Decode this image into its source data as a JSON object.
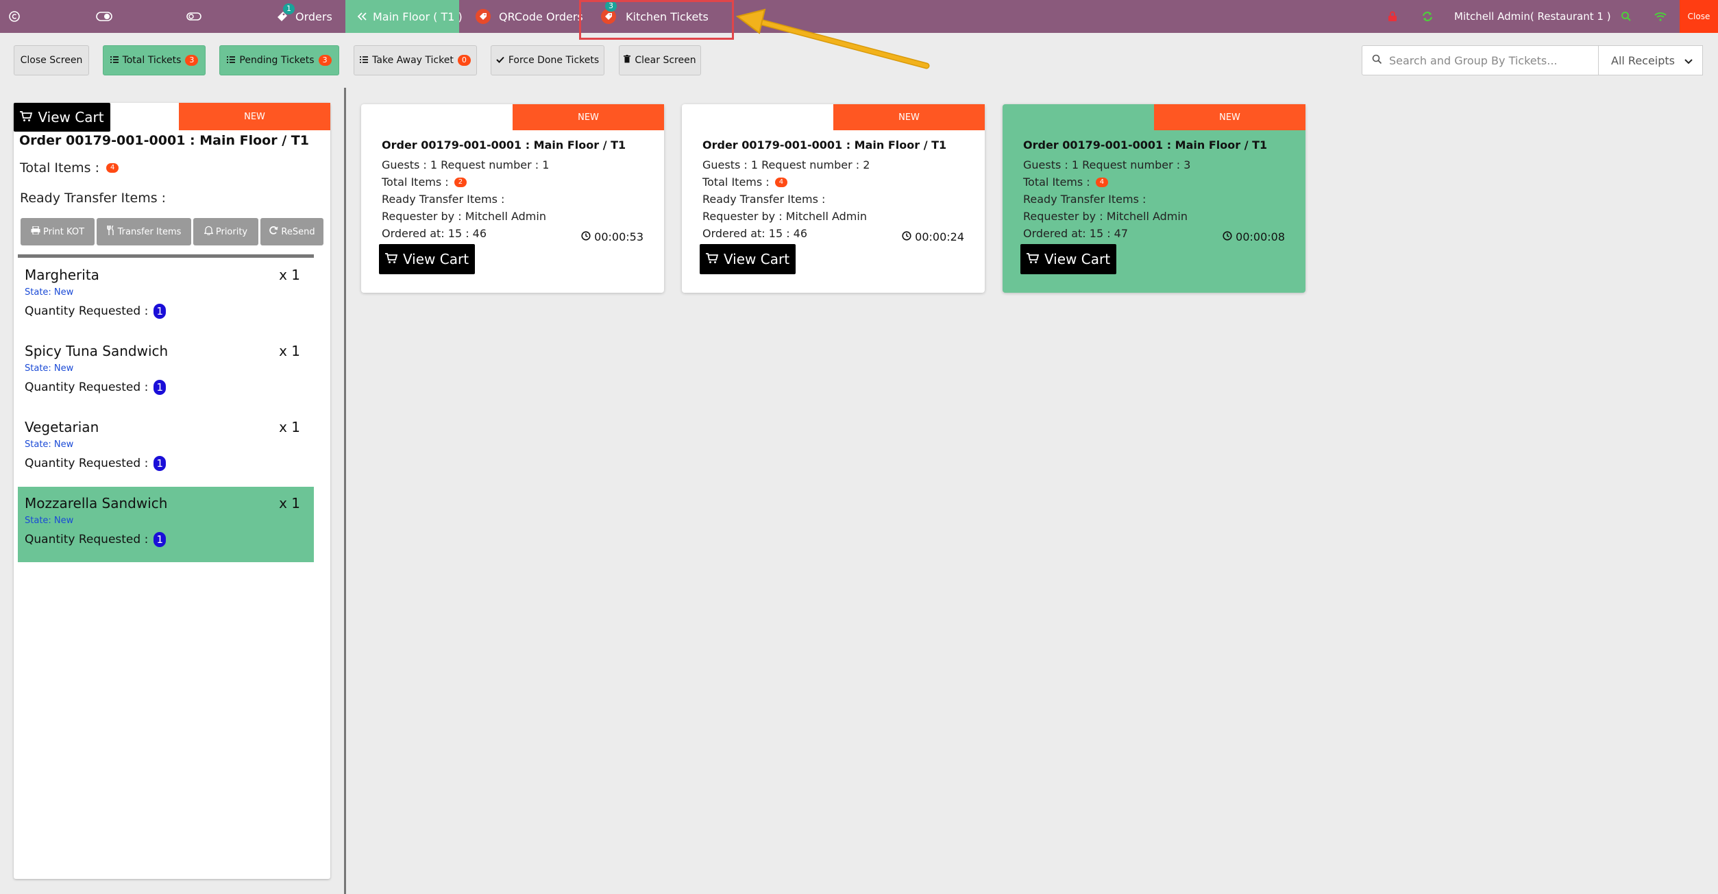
{
  "topbar": {
    "orders_label": "Orders",
    "orders_count": "1",
    "main_floor_label": "Main Floor ( T1 )",
    "qrcode_label": "QRCode Orders",
    "kitchen_label": "Kitchen Tickets",
    "kitchen_count": "3",
    "user_label": "Mitchell Admin( Restaurant 1 )",
    "close_label": "Close"
  },
  "toolbar": {
    "close_screen": "Close Screen",
    "total_tickets": "Total Tickets",
    "total_tickets_count": "3",
    "pending_tickets": "Pending Tickets",
    "pending_tickets_count": "3",
    "take_away": "Take Away Ticket",
    "take_away_count": "0",
    "force_done": "Force Done Tickets",
    "clear_screen": "Clear Screen",
    "search_placeholder": "Search and Group By Tickets...",
    "receipts_select": "All Receipts"
  },
  "left_panel": {
    "status": "NEW",
    "view_cart": "View Cart",
    "order_title": "Order 00179-001-0001 : Main Floor / T1",
    "total_items_label": "Total Items :",
    "total_items_count": "4",
    "ready_transfer_label": "Ready Transfer Items :",
    "actions": {
      "print": "Print KOT",
      "transfer": "Transfer Items",
      "priority": "Priority",
      "resend": "ReSend"
    },
    "items": [
      {
        "name": "Margherita",
        "qty": "x 1",
        "state": "State: New",
        "qty_requested_label": "Quantity Requested :",
        "qty_requested": "1"
      },
      {
        "name": "Spicy Tuna Sandwich",
        "qty": "x 1",
        "state": "State: New",
        "qty_requested_label": "Quantity Requested :",
        "qty_requested": "1"
      },
      {
        "name": "Vegetarian",
        "qty": "x 1",
        "state": "State: New",
        "qty_requested_label": "Quantity Requested :",
        "qty_requested": "1"
      },
      {
        "name": "Mozzarella Sandwich",
        "qty": "x 1",
        "state": "State: New",
        "qty_requested_label": "Quantity Requested :",
        "qty_requested": "1"
      }
    ]
  },
  "cards": [
    {
      "status": "NEW",
      "title": "Order 00179-001-0001 : Main Floor / T1",
      "guests": "Guests : 1 Request number : 1",
      "total_items_label": "Total Items :",
      "total_items": "2",
      "ready_transfer": "Ready Transfer Items :",
      "requester": "Requester by : Mitchell Admin",
      "ordered_at": "Ordered at: 15 : 46",
      "timer": "00:00:53",
      "view_cart": "View Cart"
    },
    {
      "status": "NEW",
      "title": "Order 00179-001-0001 : Main Floor / T1",
      "guests": "Guests : 1 Request number : 2",
      "total_items_label": "Total Items :",
      "total_items": "4",
      "ready_transfer": "Ready Transfer Items :",
      "requester": "Requester by : Mitchell Admin",
      "ordered_at": "Ordered at: 15 : 46",
      "timer": "00:00:24",
      "view_cart": "View Cart"
    },
    {
      "status": "NEW",
      "title": "Order 00179-001-0001 : Main Floor / T1",
      "guests": "Guests : 1 Request number : 3",
      "total_items_label": "Total Items :",
      "total_items": "4",
      "ready_transfer": "Ready Transfer Items :",
      "requester": "Requester by : Mitchell Admin",
      "ordered_at": "Ordered at: 15 : 47",
      "timer": "00:00:08",
      "view_cart": "View Cart"
    }
  ],
  "colors": {
    "topbar": "#8a5a7c",
    "accent_green": "#6cc496",
    "status_orange": "#ff5722",
    "badge_red": "#ff4a14",
    "quantity_badge": "#1a0ed8",
    "annotation_arrow": "#f2b21c",
    "highlight_box": "#e0464a"
  },
  "icons": {
    "topbar_left": [
      "copyright-icon",
      "toggle-icon",
      "link-icon"
    ],
    "topbar_right": [
      "lock-icon",
      "sync-icon",
      "search-icon",
      "wifi-icon"
    ],
    "tabs": [
      "ticket-icon",
      "chevron-double-left-icon",
      "tag-icon",
      "tag-icon"
    ],
    "toolbar": [
      "list-icon",
      "check-icon",
      "trash-icon",
      "search-icon",
      "chevron-down-icon"
    ],
    "panel": [
      "cart-icon",
      "printer-icon",
      "cutlery-icon",
      "bell-icon",
      "refresh-icon",
      "clock-icon"
    ]
  }
}
